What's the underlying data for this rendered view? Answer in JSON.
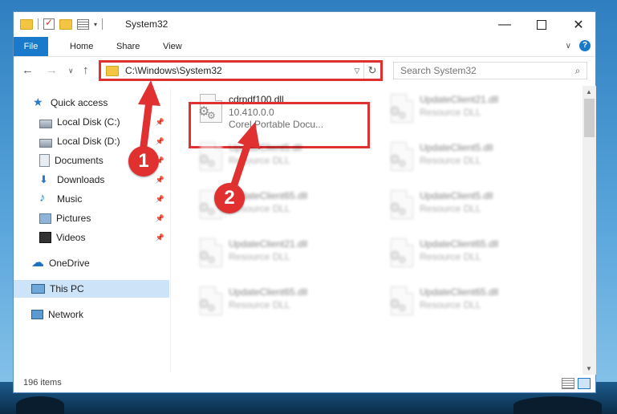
{
  "window": {
    "title": "System32",
    "controls": {
      "minimize": "—",
      "maximize": "",
      "close": "✕"
    }
  },
  "ribbon": {
    "tabs": [
      {
        "label": "File"
      },
      {
        "label": "Home"
      },
      {
        "label": "Share"
      },
      {
        "label": "View"
      }
    ]
  },
  "address": {
    "path": "C:\\Windows\\System32",
    "search_placeholder": "Search System32"
  },
  "sidebar": {
    "items": [
      {
        "label": "Quick access",
        "icon": "star-icon"
      },
      {
        "label": "Local Disk (C:)",
        "icon": "drive-icon",
        "pinned": true
      },
      {
        "label": "Local Disk (D:)",
        "icon": "drive-icon",
        "pinned": true
      },
      {
        "label": "Documents",
        "icon": "documents-icon",
        "pinned": true
      },
      {
        "label": "Downloads",
        "icon": "download-icon",
        "pinned": true
      },
      {
        "label": "Music",
        "icon": "music-icon",
        "pinned": true
      },
      {
        "label": "Pictures",
        "icon": "pictures-icon",
        "pinned": true
      },
      {
        "label": "Videos",
        "icon": "video-icon",
        "pinned": true
      },
      {
        "label": "OneDrive",
        "icon": "cloud-icon"
      },
      {
        "label": "This PC",
        "icon": "computer-icon",
        "selected": true
      },
      {
        "label": "Network",
        "icon": "network-icon"
      }
    ]
  },
  "files": [
    {
      "name": "cdrpdf100.dll",
      "line1": "10.410.0.0",
      "line2": "Corel Portable Docu...",
      "highlighted": true
    },
    {
      "name": "UpdateClient21.dll",
      "line1": "Resource DLL",
      "line2": ""
    },
    {
      "name": "UpdateClient5.dll",
      "line1": "Resource DLL",
      "line2": ""
    },
    {
      "name": "UpdateClient5.dll",
      "line1": "Resource DLL",
      "line2": ""
    },
    {
      "name": "UpdateClient65.dll",
      "line1": "Resource DLL",
      "line2": ""
    },
    {
      "name": "UpdateClient5.dll",
      "line1": "Resource DLL",
      "line2": ""
    },
    {
      "name": "UpdateClient21.dll",
      "line1": "Resource DLL",
      "line2": ""
    },
    {
      "name": "UpdateClient65.dll",
      "line1": "Resource DLL",
      "line2": ""
    },
    {
      "name": "UpdateClient65.dll",
      "line1": "Resource DLL",
      "line2": ""
    },
    {
      "name": "UpdateClient65.dll",
      "line1": "Resource DLL",
      "line2": ""
    }
  ],
  "status": {
    "item_count": "196 items"
  },
  "annotations": [
    {
      "label": "1"
    },
    {
      "label": "2"
    }
  ],
  "colors": {
    "accent": "#1979ca",
    "highlight": "#e03030",
    "selection": "#cde3f7"
  }
}
